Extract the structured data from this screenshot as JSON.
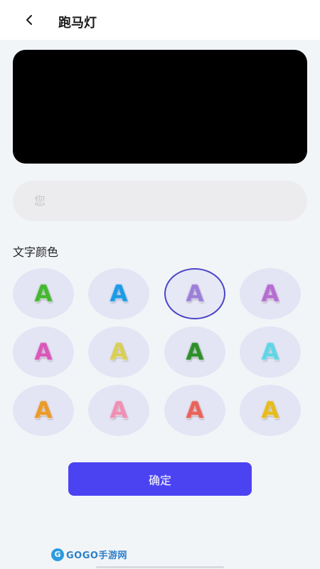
{
  "header": {
    "title": "跑马灯",
    "back_icon": "chevron-left-icon"
  },
  "preview": {
    "background": "#000000",
    "text": ""
  },
  "input": {
    "placeholder": "您",
    "value": ""
  },
  "color_section": {
    "label": "文字颜色",
    "selected_index": 2,
    "options": [
      {
        "glyph": "A",
        "color": "#45b830"
      },
      {
        "glyph": "A",
        "color": "#1c9be6"
      },
      {
        "glyph": "A",
        "color": "#9b7fd8"
      },
      {
        "glyph": "A",
        "color": "#b56dd2"
      },
      {
        "glyph": "A",
        "color": "#d957b8"
      },
      {
        "glyph": "A",
        "color": "#d9cf55"
      },
      {
        "glyph": "A",
        "color": "#2f8f2a"
      },
      {
        "glyph": "A",
        "color": "#5fd6e6"
      },
      {
        "glyph": "A",
        "color": "#eb9a2a"
      },
      {
        "glyph": "A",
        "color": "#ef8fb4"
      },
      {
        "glyph": "A",
        "color": "#e8635b"
      },
      {
        "glyph": "A",
        "color": "#e6bb1e"
      }
    ]
  },
  "confirm_button": {
    "label": "确定",
    "color": "#4b43f2"
  },
  "watermark": {
    "text": "GOGO手游网"
  }
}
